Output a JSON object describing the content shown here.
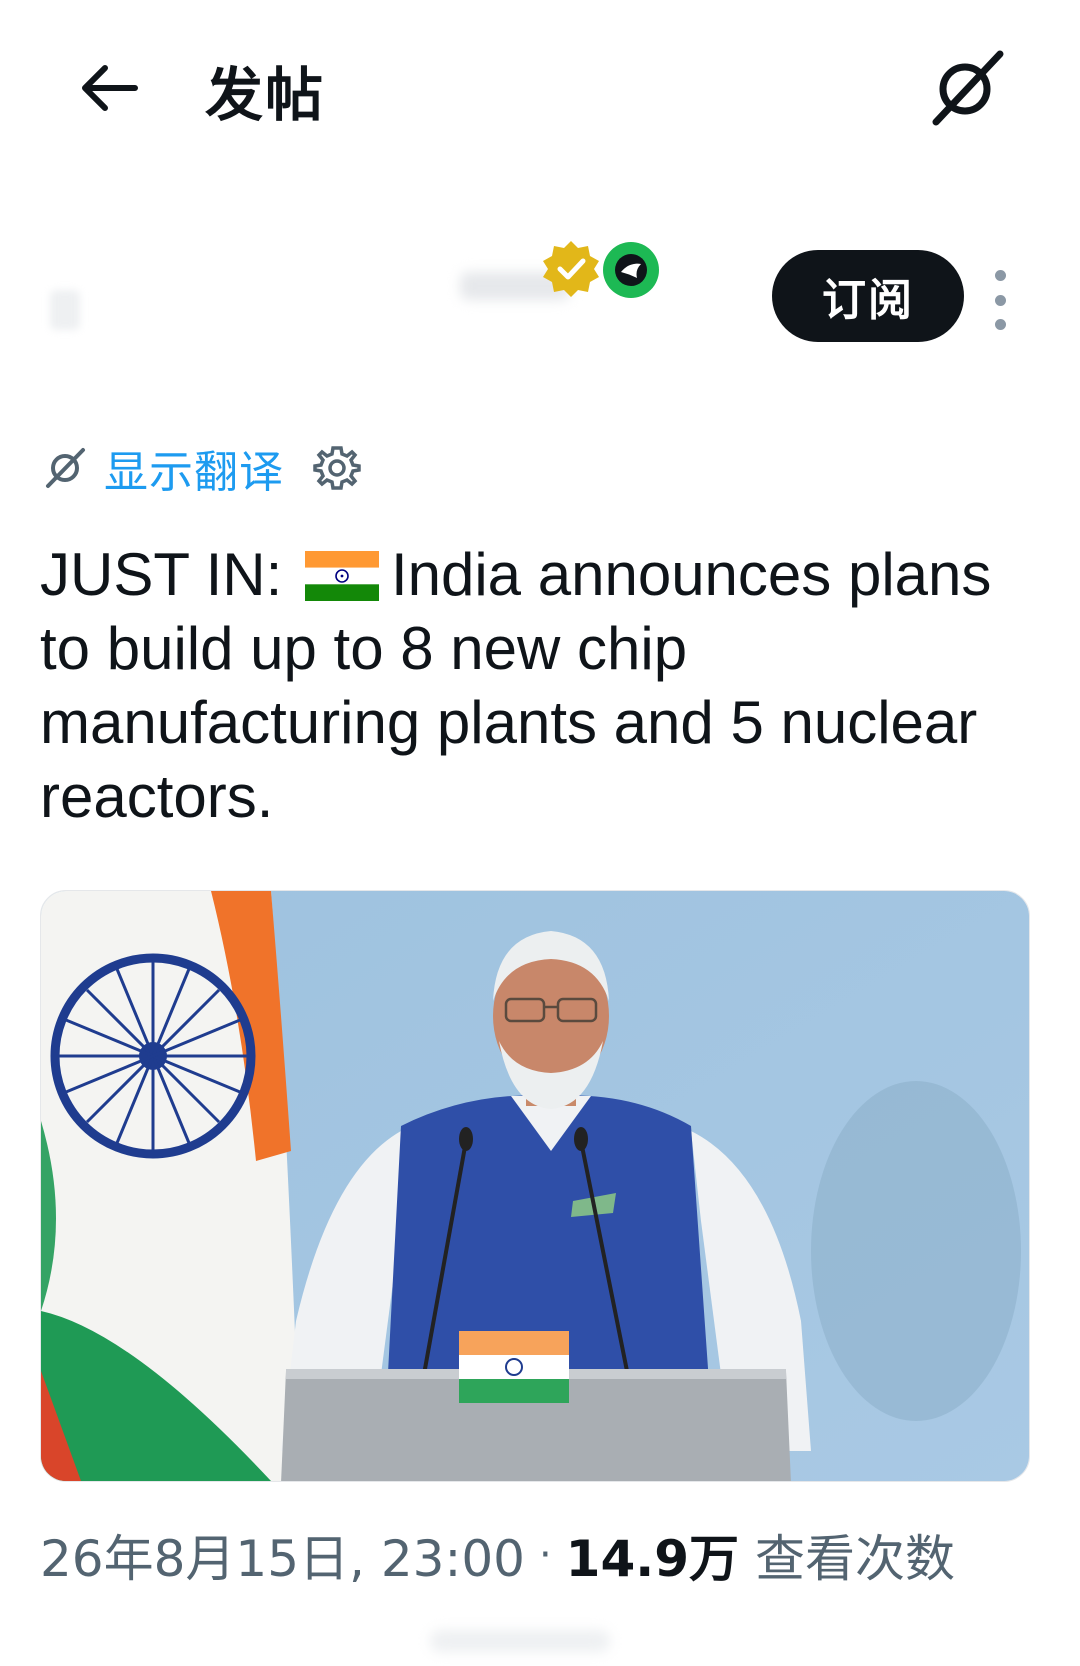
{
  "header": {
    "title": "发帖"
  },
  "author": {
    "subscribe_label": "订阅"
  },
  "translate": {
    "label": "显示翻译"
  },
  "post": {
    "text_before_flag": "JUST IN: ",
    "flag_emoji": "india-flag",
    "text_after_flag": "India announces plans to build up to 8 new chip manufacturing plants and 5 nuclear reactors."
  },
  "meta": {
    "timestamp": "26年8月15日, 23:00",
    "separator": "·",
    "views": "14.9万",
    "views_label": "查看次数"
  },
  "colors": {
    "accent": "#1d9bf0",
    "text_primary": "#0f1419",
    "text_secondary": "#536471",
    "button_bg": "#0f1419"
  },
  "icons": {
    "back": "arrow-left-icon",
    "grok": "grok-icon",
    "verified": "verified-badge-icon",
    "more": "more-vertical-icon",
    "translate": "grok-icon",
    "settings": "gear-icon"
  }
}
